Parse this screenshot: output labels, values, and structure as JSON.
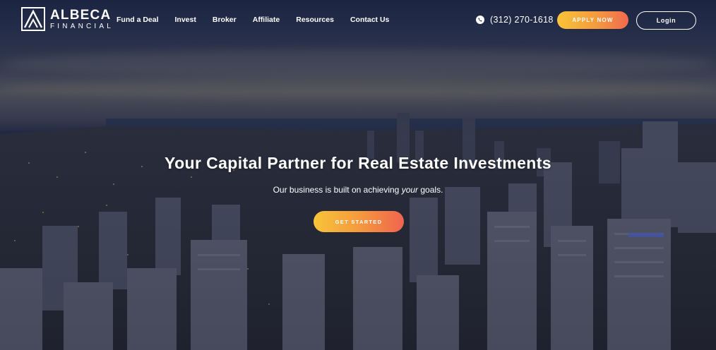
{
  "brand": {
    "name_line1": "ALBECA",
    "name_line2": "FINANCIAL",
    "icon": "albeca-logo-mark"
  },
  "nav": {
    "links": [
      {
        "label": "Fund a Deal"
      },
      {
        "label": "Invest"
      },
      {
        "label": "Broker"
      },
      {
        "label": "Affiliate"
      },
      {
        "label": "Resources"
      },
      {
        "label": "Contact Us"
      }
    ],
    "phone_icon": "phone-icon",
    "phone": "(312) 270-1618",
    "apply_label": "APPLY NOW",
    "login_label": "Login"
  },
  "hero": {
    "title": "Your Capital Partner for Real Estate Investments",
    "subtitle_before": "Our business is built on achieving ",
    "subtitle_emphasis": "your",
    "subtitle_after": " goals.",
    "cta_label": "GET STARTED"
  },
  "colors": {
    "accent_start": "#f8c43a",
    "accent_end": "#f0644e",
    "text": "#ffffff",
    "sky": "#1f2a4a"
  }
}
